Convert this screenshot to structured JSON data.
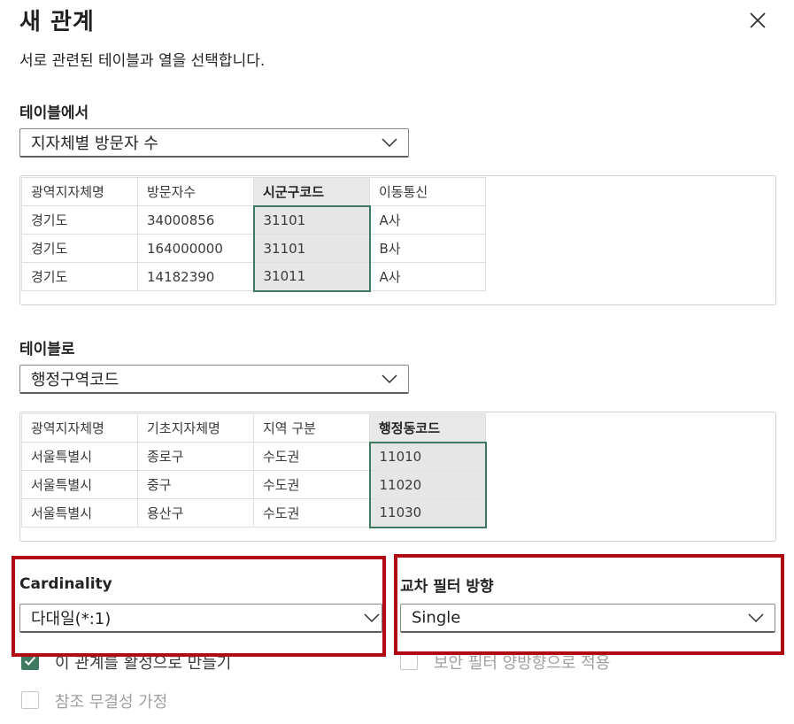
{
  "dialog": {
    "title": "새 관계",
    "subtitle": "서로 관련된 테이블과 열을 선택합니다."
  },
  "from_table": {
    "label": "테이블에서",
    "selected": "지자체별 방문자 수",
    "columns": [
      "광역지자체명",
      "방문자수",
      "시군구코드",
      "이동통신"
    ],
    "rows": [
      [
        "경기도",
        "34000856",
        "31101",
        "A사"
      ],
      [
        "경기도",
        "164000000",
        "31101",
        "B사"
      ],
      [
        "경기도",
        "14182390",
        "31011",
        "A사"
      ]
    ]
  },
  "to_table": {
    "label": "테이블로",
    "selected": "행정구역코드",
    "columns": [
      "광역지자체명",
      "기초지자체명",
      "지역 구분",
      "행정동코드"
    ],
    "rows": [
      [
        "서울특별시",
        "종로구",
        "수도권",
        "11010"
      ],
      [
        "서울특별시",
        "중구",
        "수도권",
        "11020"
      ],
      [
        "서울특별시",
        "용산구",
        "수도권",
        "11030"
      ]
    ]
  },
  "cardinality": {
    "label": "Cardinality",
    "selected": "다대일(*:1)"
  },
  "cross_filter": {
    "label": "교차 필터 방향",
    "selected": "Single"
  },
  "options": {
    "make_active": "이 관계를 활성으로 만들기",
    "security_filter": "보안 필터 양방향으로 적용",
    "assume_integrity": "참조 무결성 가정"
  },
  "colors": {
    "highlight_border": "#b00b12",
    "selected_column_border": "#3e7a5f",
    "checkbox_checked": "#3e7a5f"
  },
  "icons": {
    "close": "close-icon",
    "dropdown": "chevron-down-icon",
    "check": "checkmark-icon"
  }
}
